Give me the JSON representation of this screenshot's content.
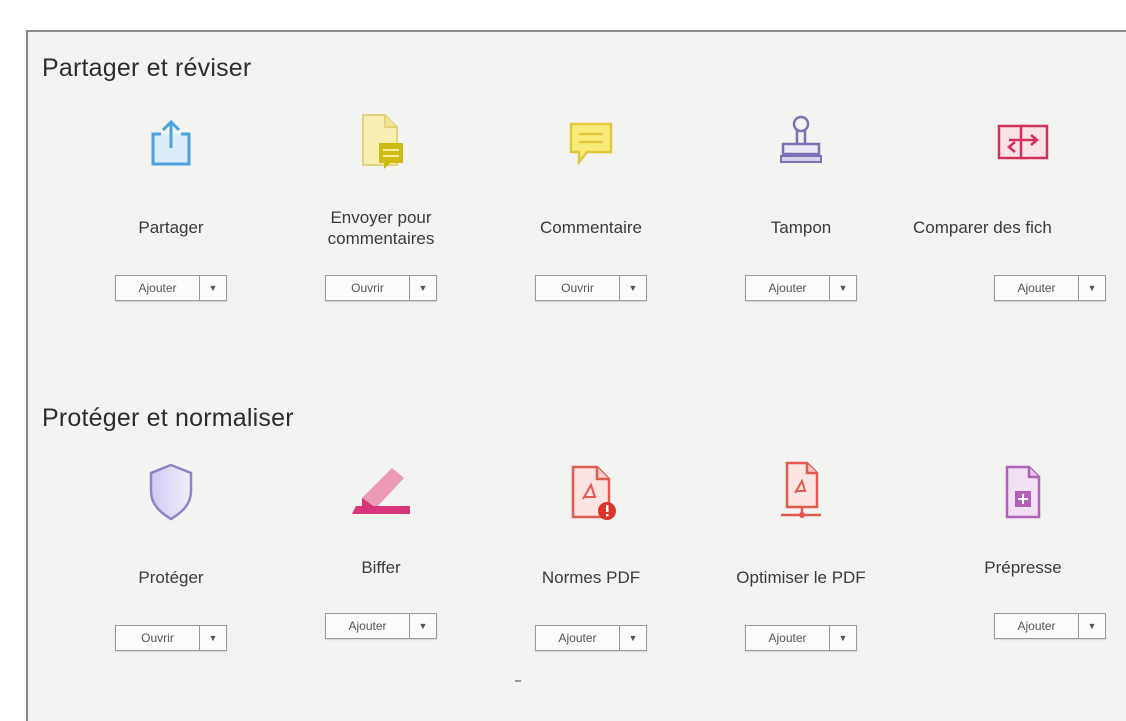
{
  "sections": [
    {
      "title": "Partager et réviser",
      "tools": [
        {
          "label": "Partager",
          "button": "Ajouter",
          "icon": "share-icon"
        },
        {
          "label": "Envoyer pour\ncommentaires",
          "button": "Ouvrir",
          "icon": "send-for-comments-icon"
        },
        {
          "label": "Commentaire",
          "button": "Ouvrir",
          "icon": "comment-icon"
        },
        {
          "label": "Tampon",
          "button": "Ajouter",
          "icon": "stamp-icon"
        },
        {
          "label": "Comparer des fich",
          "button": "Ajouter",
          "icon": "compare-files-icon"
        }
      ]
    },
    {
      "title": "Protéger et normaliser",
      "tools": [
        {
          "label": "Protéger",
          "button": "Ouvrir",
          "icon": "protect-shield-icon"
        },
        {
          "label": "Biffer",
          "button": "Ajouter",
          "icon": "redact-marker-icon"
        },
        {
          "label": "Normes PDF",
          "button": "Ajouter",
          "icon": "pdf-standards-icon"
        },
        {
          "label": "Optimiser le PDF",
          "button": "Ajouter",
          "icon": "optimize-pdf-icon"
        },
        {
          "label": "Prépresse",
          "button": "Ajouter",
          "icon": "prepress-icon"
        }
      ]
    }
  ],
  "colors": {
    "panel_bg": "#f3f3f1",
    "share_blue": "#4ba3de",
    "send_yellow": "#d4c21c",
    "comment_yellow": "#f0dc3c",
    "stamp_purple": "#7c6fb4",
    "compare_pink": "#d2325a",
    "shield_lavender": "#8a85c8",
    "redact_pink": "#d8357a",
    "pdf_red": "#e05a4f",
    "prepress_purple": "#b061b8"
  }
}
